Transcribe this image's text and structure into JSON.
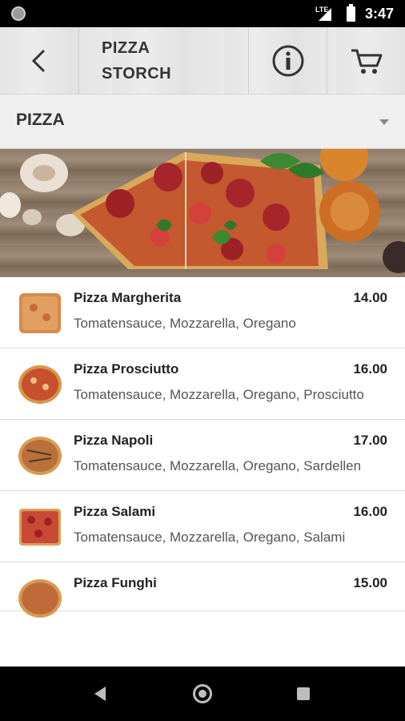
{
  "status_bar": {
    "network": "LTE",
    "time": "3:47"
  },
  "header": {
    "title_line1": "PIZZA",
    "title_line2": "STORCH",
    "back_icon": "chevron-left-icon",
    "info_icon": "info-icon",
    "cart_icon": "cart-icon"
  },
  "category": {
    "selected": "PIZZA"
  },
  "menu": {
    "items": [
      {
        "name": "Pizza Margherita",
        "price": "14.00",
        "description": "Tomatensauce, Mozzarella, Oregano"
      },
      {
        "name": "Pizza Prosciutto",
        "price": "16.00",
        "description": "Tomatensauce, Mozzarella, Oregano, Prosciutto"
      },
      {
        "name": "Pizza Napoli",
        "price": "17.00",
        "description": "Tomatensauce, Mozzarella, Oregano, Sardellen"
      },
      {
        "name": "Pizza Salami",
        "price": "16.00",
        "description": "Tomatensauce, Mozzarella, Oregano, Salami"
      },
      {
        "name": "Pizza Funghi",
        "price": "15.00",
        "description": ""
      }
    ]
  }
}
